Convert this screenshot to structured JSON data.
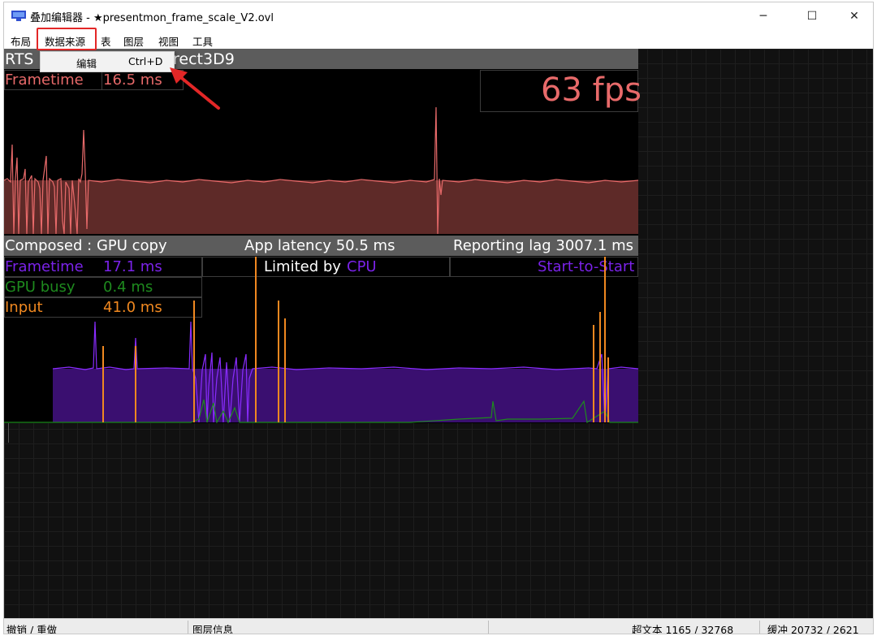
{
  "window": {
    "title": "叠加编辑器 - ★presentmon_frame_scale_V2.ovl",
    "controls": {
      "minimize": "─",
      "maximize": "☐",
      "close": "✕"
    }
  },
  "menu": {
    "items": [
      "布局",
      "数据来源",
      "表",
      "图层",
      "视图",
      "工具"
    ]
  },
  "dropdown": {
    "label": "编辑",
    "shortcut": "Ctrl+D"
  },
  "overlay": {
    "header_left": "RTS",
    "header_right": "rect3D9",
    "frametime_label": "Frametime",
    "frametime_value": "16.5 ms",
    "fps": "63 fps",
    "composed": "Composed : GPU copy",
    "app_latency": "App latency 50.5 ms",
    "reporting_lag": "Reporting lag 3007.1 ms",
    "frametime2_label": "Frametime",
    "frametime2_value": "17.1 ms",
    "limited_by": "Limited by",
    "limited_by_value": "CPU",
    "start_to_start": "Start-to-Start",
    "gpu_busy_label": "GPU busy",
    "gpu_busy_value": "0.4 ms",
    "input_label": "Input",
    "input_value": "41.0 ms"
  },
  "colors": {
    "frametime": "#e86a6a",
    "frametime_fill": "#5e2a28",
    "purple": "#7a22e8",
    "purple_fill": "#3a0f70",
    "green": "#1e8a1e",
    "orange": "#f08820",
    "annotation": "#e32727"
  },
  "status": {
    "undo_redo": "撤销 / 重做",
    "layer_info": "图层信息",
    "rich_text": "超文本 1165 / 32768",
    "buffer": "缓冲 20732 / 2621"
  }
}
